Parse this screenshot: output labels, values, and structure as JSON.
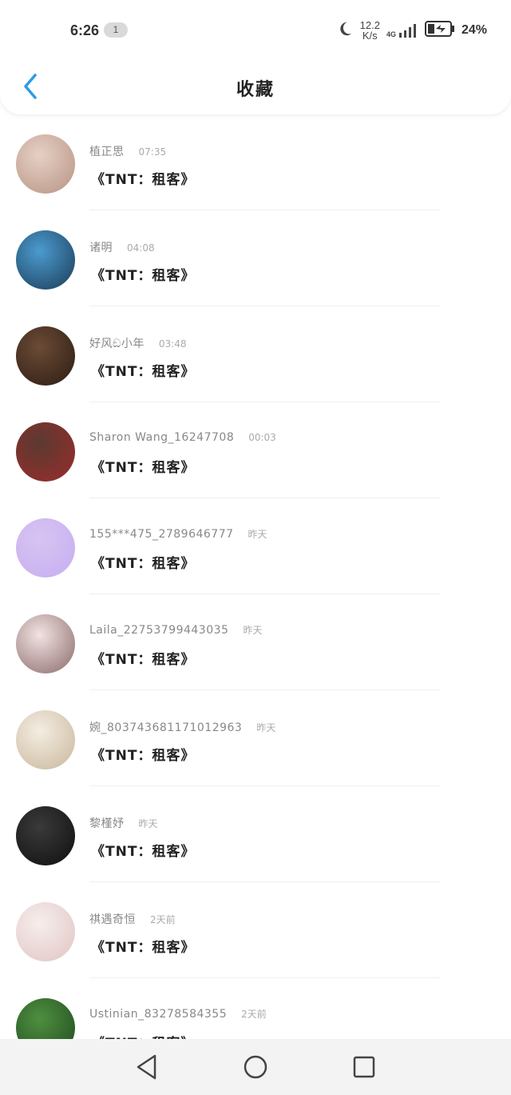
{
  "status_bar": {
    "time": "6:26",
    "notification_count": "1",
    "speed_value": "12.2",
    "speed_unit": "K/s",
    "network_type": "4G",
    "battery_percent": "24%"
  },
  "nav": {
    "title": "收藏",
    "back_icon": "chevron-left-icon"
  },
  "items": [
    {
      "name": "植正思",
      "time": "07:35",
      "content": "《TNT：租客》",
      "avatar_colors": [
        "#e6d0c6",
        "#b79382"
      ]
    },
    {
      "name": "诸明",
      "time": "04:08",
      "content": "《TNT：租客》",
      "avatar_colors": [
        "#4b9bd0",
        "#1c3b55"
      ]
    },
    {
      "name": "好风ඞ小年",
      "time": "03:48",
      "content": "《TNT：租客》",
      "avatar_colors": [
        "#6b4b36",
        "#2c1c12"
      ]
    },
    {
      "name": "Sharon Wang_16247708",
      "time": "00:03",
      "content": "《TNT：租客》",
      "avatar_colors": [
        "#5a3a30",
        "#9b2c2c"
      ]
    },
    {
      "name": "155***475_2789646777",
      "time": "昨天",
      "content": "《TNT：租客》",
      "avatar_colors": [
        "#d8c4f2",
        "#c6aef0"
      ]
    },
    {
      "name": "Laila_22753799443035",
      "time": "昨天",
      "content": "《TNT：租客》",
      "avatar_colors": [
        "#f2e2e2",
        "#8a6a6a"
      ]
    },
    {
      "name": "婉_803743681171012963",
      "time": "昨天",
      "content": "《TNT：租客》",
      "avatar_colors": [
        "#f4ede2",
        "#c9b69b"
      ]
    },
    {
      "name": "黎槿妤",
      "time": "昨天",
      "content": "《TNT：租客》",
      "avatar_colors": [
        "#3a3a3a",
        "#0f0f0f"
      ]
    },
    {
      "name": "祺遇奇恒",
      "time": "2天前",
      "content": "《TNT：租客》",
      "avatar_colors": [
        "#f6eeec",
        "#e0c4c4"
      ]
    },
    {
      "name": "Ustinian_83278584355",
      "time": "2天前",
      "content": "《TNT：租客》",
      "avatar_colors": [
        "#4f8f3f",
        "#1f4a20"
      ]
    }
  ],
  "bottom_nav": {
    "back": "triangle-back-icon",
    "home": "circle-home-icon",
    "recents": "square-recents-icon"
  },
  "colors": {
    "accent": "#2f9be5",
    "title": "#222222",
    "meta": "#888888"
  }
}
